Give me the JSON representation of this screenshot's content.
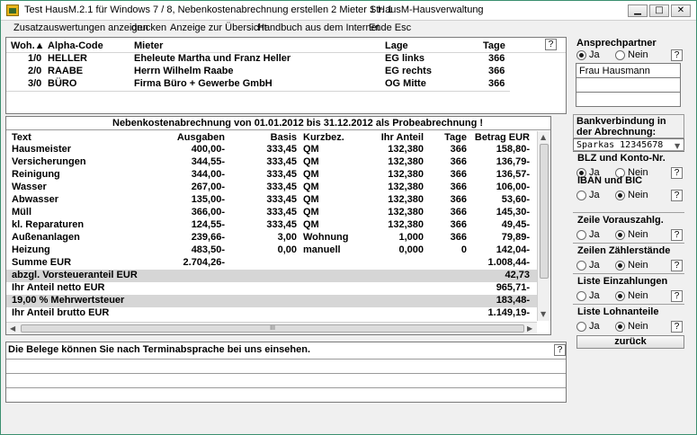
{
  "titlebar": {
    "title": "Test HausM.2.1 für Windows 7 / 8, Nebenkostenabrechnung erstellen 2  Mieter Str. 1",
    "app_name": "1 HausM-Hausverwaltung",
    "minimize": "▁",
    "maximize": "□",
    "close": "✕"
  },
  "menu": {
    "items": [
      "Zusatzauswertungen anzeigen",
      "drucken",
      "Anzeige zur Übersicht",
      "Handbuch aus dem Internet",
      "Ende Esc"
    ]
  },
  "tenants": {
    "columns": [
      "Woh.▲",
      "Alpha-Code",
      "Mieter",
      "Lage",
      "Tage"
    ],
    "help": "?",
    "rows": [
      {
        "woh": "1/0",
        "alpha": "HELLER",
        "mieter": "Eheleute Martha und Franz Heller",
        "lage": "EG links",
        "tage": "366"
      },
      {
        "woh": "2/0",
        "alpha": "RAABE",
        "mieter": "Herrn Wilhelm Raabe",
        "lage": "EG rechts",
        "tage": "366"
      },
      {
        "woh": "3/0",
        "alpha": "BÜRO",
        "mieter": "Firma Büro + Gewerbe GmbH",
        "lage": "OG Mitte",
        "tage": "366"
      }
    ]
  },
  "billing": {
    "header": "Nebenkostenabrechnung von 01.01.2012 bis 31.12.2012 als Probeabrechnung !",
    "columns": [
      "Text",
      "Ausgaben",
      "Basis",
      "Kurzbez.",
      "Ihr Anteil",
      "Tage",
      "Betrag EUR"
    ],
    "rows": [
      {
        "text": "Hausmeister",
        "ausgaben": "400,00-",
        "basis": "333,45",
        "kurz": "QM",
        "anteil": "132,380",
        "tage": "366",
        "betrag": "158,80-"
      },
      {
        "text": "Versicherungen",
        "ausgaben": "344,55-",
        "basis": "333,45",
        "kurz": "QM",
        "anteil": "132,380",
        "tage": "366",
        "betrag": "136,79-"
      },
      {
        "text": "Reinigung",
        "ausgaben": "344,00-",
        "basis": "333,45",
        "kurz": "QM",
        "anteil": "132,380",
        "tage": "366",
        "betrag": "136,57-"
      },
      {
        "text": "Wasser",
        "ausgaben": "267,00-",
        "basis": "333,45",
        "kurz": "QM",
        "anteil": "132,380",
        "tage": "366",
        "betrag": "106,00-"
      },
      {
        "text": "Abwasser",
        "ausgaben": "135,00-",
        "basis": "333,45",
        "kurz": "QM",
        "anteil": "132,380",
        "tage": "366",
        "betrag": "53,60-"
      },
      {
        "text": "Müll",
        "ausgaben": "366,00-",
        "basis": "333,45",
        "kurz": "QM",
        "anteil": "132,380",
        "tage": "366",
        "betrag": "145,30-"
      },
      {
        "text": "kl. Reparaturen",
        "ausgaben": "124,55-",
        "basis": "333,45",
        "kurz": "QM",
        "anteil": "132,380",
        "tage": "366",
        "betrag": "49,45-"
      },
      {
        "text": "Außenanlagen",
        "ausgaben": "239,66-",
        "basis": "3,00",
        "kurz": "Wohnung",
        "anteil": "1,000",
        "tage": "366",
        "betrag": "79,89-"
      },
      {
        "text": "Heizung",
        "ausgaben": "483,50-",
        "basis": "0,00",
        "kurz": "manuell",
        "anteil": "0,000",
        "tage": "0",
        "betrag": "142,04-"
      }
    ],
    "summary": [
      {
        "text": "Summe EUR",
        "ausgaben": "2.704,26-",
        "betrag": "1.008,44-",
        "gray": false
      },
      {
        "text": "abzgl. Vorsteueranteil EUR",
        "ausgaben": "",
        "betrag": "42,73",
        "gray": true
      },
      {
        "text": "Ihr Anteil netto EUR",
        "ausgaben": "",
        "betrag": "965,71-",
        "gray": false
      },
      {
        "text": "19,00 % Mehrwertsteuer",
        "ausgaben": "",
        "betrag": "183,48-",
        "gray": true
      },
      {
        "text": "Ihr Anteil brutto EUR",
        "ausgaben": "",
        "betrag": "1.149,19-",
        "gray": false
      }
    ],
    "hscroll_grip": "III"
  },
  "notes": {
    "text": "Die Belege können Sie nach Terminabsprache bei uns einsehen.",
    "help": "?"
  },
  "side": {
    "ansprechpartner_label": "Ansprechpartner",
    "ansprechpartner_value": "Frau Hausmann",
    "bank_label": "Bankverbindung in der Abrechnung:",
    "bank_value": "Sparkas 12345678",
    "ja": "Ja",
    "nein": "Nein",
    "help": "?",
    "options": [
      {
        "label": "BLZ und Konto-Nr.",
        "selected": "Ja"
      },
      {
        "label": "IBAN und BIC",
        "selected": "Nein"
      },
      {
        "label": "Zeile Vorauszahlg.",
        "selected": "Nein"
      },
      {
        "label": "Zeilen Zählerstände",
        "selected": "Nein"
      },
      {
        "label": "Liste  Einzahlungen",
        "selected": "Nein"
      },
      {
        "label": "Liste Lohnanteile",
        "selected": "Nein"
      }
    ],
    "ansprechpartner_selected": "Ja",
    "back_button": "zurück"
  }
}
